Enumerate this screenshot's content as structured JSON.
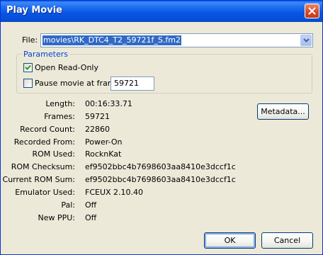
{
  "window": {
    "title": "Play Movie"
  },
  "file": {
    "label": "File:",
    "selected": "movies\\RK_DTC4_T2_59721f_S.fm2"
  },
  "parameters": {
    "legend": "Parameters",
    "read_only_label": "Open Read-Only",
    "read_only_checked": true,
    "pause_label": "Pause movie at frame",
    "pause_checked": false,
    "pause_frame": "59721"
  },
  "info": {
    "length_label": "Length:",
    "length_value": "00:16:33.71",
    "frames_label": "Frames:",
    "frames_value": "59721",
    "record_count_label": "Record Count:",
    "record_count_value": "22860",
    "recorded_from_label": "Recorded From:",
    "recorded_from_value": "Power-On",
    "rom_used_label": "ROM Used:",
    "rom_used_value": "RocknKat",
    "rom_checksum_label": "ROM Checksum:",
    "rom_checksum_value": "ef9502bbc4b7698603aa8410e3dccf1c",
    "current_rom_sum_label": "Current ROM Sum:",
    "current_rom_sum_value": "ef9502bbc4b7698603aa8410e3dccf1c",
    "emulator_used_label": "Emulator Used:",
    "emulator_used_value": "FCEUX 2.10.40",
    "pal_label": "Pal:",
    "pal_value": "Off",
    "new_ppu_label": "New PPU:",
    "new_ppu_value": "Off"
  },
  "buttons": {
    "metadata": "Metadata...",
    "ok": "OK",
    "cancel": "Cancel"
  },
  "colors": {
    "titlebar": "#0854e3",
    "selection": "#316ac5",
    "group_legend": "#0046d5",
    "face": "#ece9d8"
  },
  "icons": {
    "close": "close-icon",
    "dropdown": "chevron-down-icon",
    "check": "checkmark-icon"
  }
}
